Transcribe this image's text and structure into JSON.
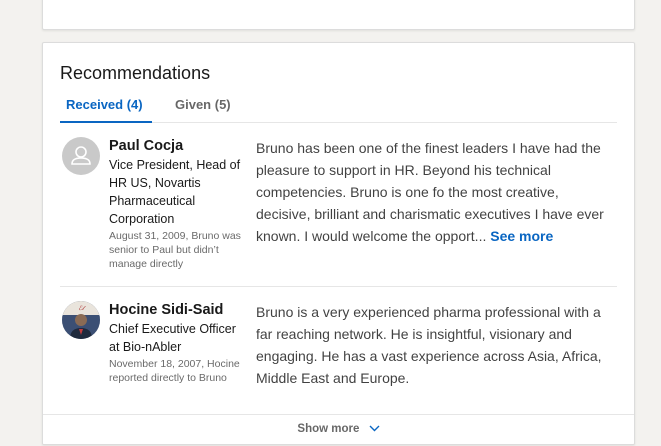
{
  "section": {
    "title": "Recommendations"
  },
  "tabs": [
    {
      "label": "Received (4)",
      "active": true
    },
    {
      "label": "Given (5)",
      "active": false
    }
  ],
  "recommendations": [
    {
      "name": "Paul Cocja",
      "title": "Vice President, Head of HR US, Novartis Pharmaceutical Corporation",
      "meta": "August 31, 2009, Bruno was senior to Paul but didn’t manage directly",
      "avatar": "ghost-person-icon",
      "text": "Bruno has been one of the finest leaders I have had the pleasure to support in HR. Beyond his technical competencies. Bruno is one fo the most creative, decisive, brilliant and charismatic executives I have ever known. I would welcome the opport...",
      "see_more": "See more"
    },
    {
      "name": "Hocine Sidi-Said",
      "title": "Chief Executive Officer at Bio-nAbler",
      "meta": "November 18, 2007, Hocine reported directly to Bruno",
      "avatar": "profile-photo",
      "text": "Bruno is a very experienced pharma professional with a far reaching network. He is insightful, visionary and engaging. He has a vast experience across Asia, Africa, Middle East and Europe.",
      "see_more": ""
    }
  ],
  "footer": {
    "show_more": "Show more",
    "icon": "chevron-down-icon"
  },
  "colors": {
    "accent": "#0a66c2",
    "background": "#f3f2ef",
    "card": "#ffffff"
  }
}
